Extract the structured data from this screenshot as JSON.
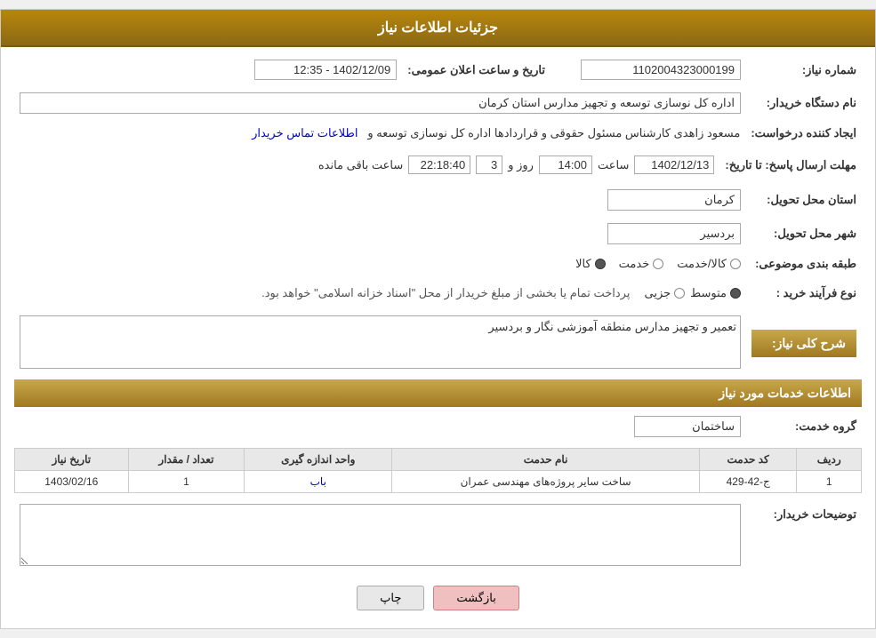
{
  "header": {
    "title": "جزئیات اطلاعات نیاز"
  },
  "fields": {
    "need_number_label": "شماره نیاز:",
    "need_number_value": "1102004323000199",
    "announcement_date_label": "تاریخ و ساعت اعلان عمومی:",
    "announcement_date_value": "1402/12/09 - 12:35",
    "buyer_org_label": "نام دستگاه خریدار:",
    "buyer_org_value": "اداره کل نوسازی  توسعه و تجهیز مدارس استان کرمان",
    "creator_label": "ایجاد کننده درخواست:",
    "creator_value": "مسعود زاهدی کارشناس مسئول حقوقی و قراردادها اداره کل نوسازی  توسعه و",
    "creator_link": "اطلاعات تماس خریدار",
    "deadline_label": "مهلت ارسال پاسخ: تا تاریخ:",
    "deadline_date": "1402/12/13",
    "deadline_time_label": "ساعت",
    "deadline_time": "14:00",
    "deadline_days_label": "روز و",
    "deadline_days": "3",
    "deadline_remaining_label": "ساعت باقی مانده",
    "deadline_remaining": "22:18:40",
    "province_label": "استان محل تحویل:",
    "province_value": "کرمان",
    "city_label": "شهر محل تحویل:",
    "city_value": "بردسیر",
    "category_label": "طبقه بندی موضوعی:",
    "category_options": [
      "کالا",
      "خدمت",
      "کالا/خدمت"
    ],
    "category_selected": "کالا",
    "purchase_type_label": "نوع فرآیند خرید :",
    "purchase_type_note": "پرداخت تمام یا بخشی از مبلغ خریدار از محل \"اسناد خزانه اسلامی\" خواهد بود.",
    "purchase_type_options": [
      "جزیی",
      "متوسط"
    ],
    "purchase_type_selected": "متوسط",
    "description_section_label": "شرح کلی نیاز:",
    "description_value": "تعمیر و تجهیز مدارس منطقه آموزشی نگار و بردسیر",
    "services_section_title": "اطلاعات خدمات مورد نیاز",
    "service_group_label": "گروه خدمت:",
    "service_group_value": "ساختمان"
  },
  "table": {
    "columns": [
      "ردیف",
      "کد حدمت",
      "نام حدمت",
      "واحد اندازه گیری",
      "تعداد / مقدار",
      "تاریخ نیاز"
    ],
    "rows": [
      {
        "row_num": "1",
        "service_code": "ج-42-429",
        "service_name": "ساخت سایر پروژه‌های مهندسی عمران",
        "unit": "باب",
        "quantity": "1",
        "date": "1403/02/16"
      }
    ]
  },
  "buyer_notes_label": "توضیحات خریدار:",
  "buyer_notes_value": "",
  "buttons": {
    "print_label": "چاپ",
    "back_label": "بازگشت"
  }
}
